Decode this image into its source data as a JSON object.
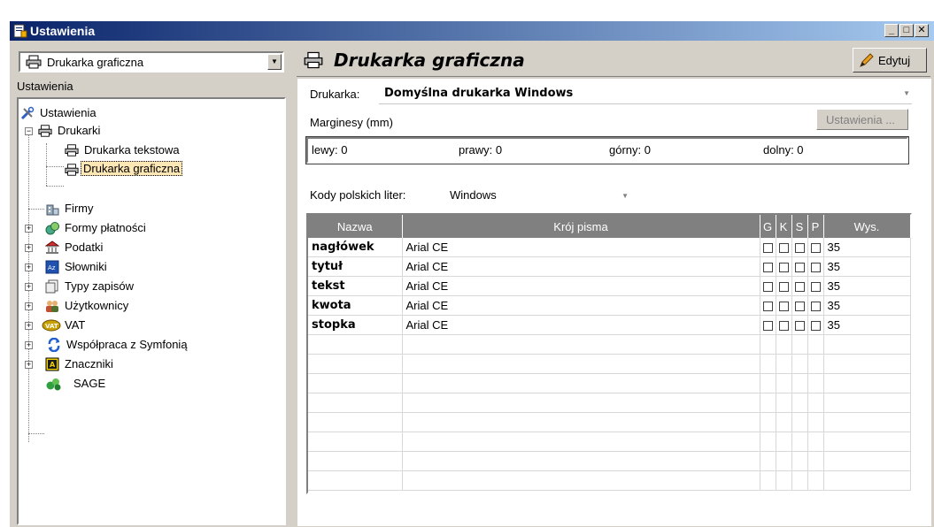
{
  "window": {
    "title": "Ustawienia"
  },
  "left": {
    "combo_value": "Drukarka graficzna",
    "tree_label": "Ustawienia",
    "tree": [
      {
        "label": "Ustawienia",
        "icon": "tools-icon"
      },
      {
        "label": "Drukarki",
        "icon": "printer-icon"
      },
      {
        "label": "Drukarka tekstowa",
        "icon": "printer-icon"
      },
      {
        "label": "Drukarka graficzna",
        "icon": "printer-icon"
      },
      {
        "label": "Firmy",
        "icon": "building-icon"
      },
      {
        "label": "Formy płatności",
        "icon": "payment-icon"
      },
      {
        "label": "Podatki",
        "icon": "bank-icon"
      },
      {
        "label": "Słowniki",
        "icon": "dictionary-icon"
      },
      {
        "label": "Typy zapisów",
        "icon": "document-icon"
      },
      {
        "label": "Użytkownicy",
        "icon": "users-icon"
      },
      {
        "label": "VAT",
        "icon": "vat-icon"
      },
      {
        "label": "Współpraca z Symfonią",
        "icon": "sync-icon"
      },
      {
        "label": "Znaczniki",
        "icon": "tag-icon"
      },
      {
        "label": "SAGE",
        "icon": "sage-icon"
      }
    ]
  },
  "right": {
    "title": "Drukarka graficzna",
    "edit_button": "Edytuj",
    "printer_label": "Drukarka:",
    "printer_value": "Domyślna drukarka Windows",
    "margins_label": "Marginesy (mm)",
    "settings_button": "Ustawienia ...",
    "margins": {
      "left": "lewy:  0",
      "right": "prawy:  0",
      "top": "górny:  0",
      "bottom": "dolny:  0"
    },
    "codes_label": "Kody polskich liter:",
    "codes_value": "Windows",
    "table": {
      "headers": [
        "Nazwa",
        "Krój pisma",
        "G",
        "K",
        "S",
        "P",
        "Wys."
      ],
      "rows": [
        {
          "name": "nagłówek",
          "font": "Arial CE",
          "height": "35"
        },
        {
          "name": "tytuł",
          "font": "Arial CE",
          "height": "35"
        },
        {
          "name": "tekst",
          "font": "Arial CE",
          "height": "35"
        },
        {
          "name": "kwota",
          "font": "Arial CE",
          "height": "35"
        },
        {
          "name": "stopka",
          "font": "Arial CE",
          "height": "35"
        }
      ]
    }
  }
}
